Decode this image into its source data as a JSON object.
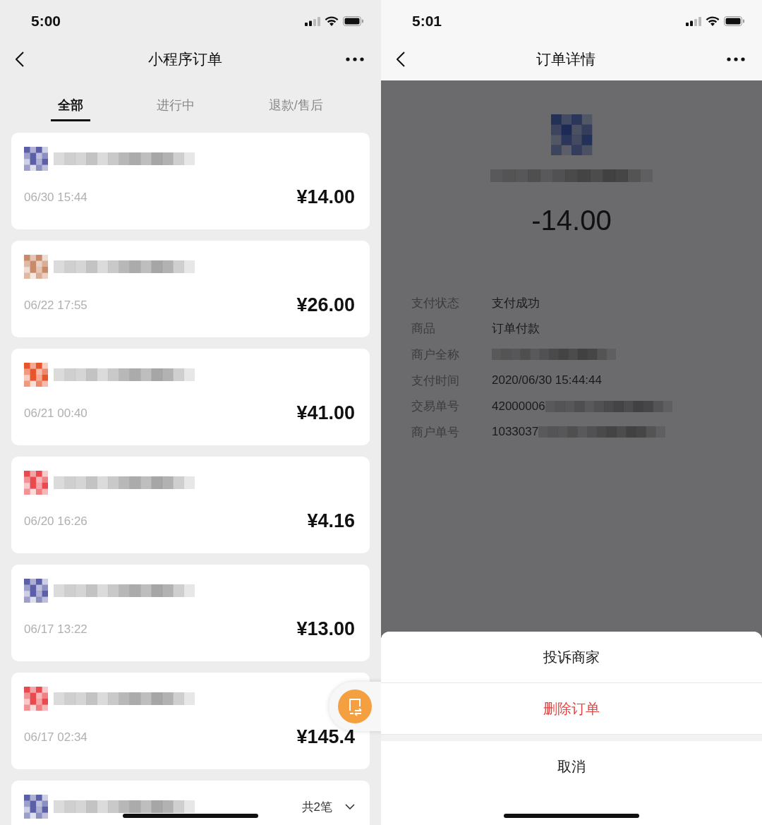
{
  "left": {
    "status_bar": {
      "time": "5:00"
    },
    "nav": {
      "title": "小程序订单"
    },
    "tabs": [
      {
        "label": "全部",
        "selected": true
      },
      {
        "label": "进行中",
        "selected": false
      },
      {
        "label": "退款/售后",
        "selected": false
      }
    ],
    "orders": [
      {
        "date": "06/30 15:44",
        "amount": "¥14.00",
        "color": "#5b5fa8"
      },
      {
        "date": "06/22 17:55",
        "amount": "¥26.00",
        "color": "#c98a6a"
      },
      {
        "date": "06/21 00:40",
        "amount": "¥41.00",
        "color": "#e8552a"
      },
      {
        "date": "06/20 16:26",
        "amount": "¥4.16",
        "color": "#e84a4f"
      },
      {
        "date": "06/17 13:22",
        "amount": "¥13.00",
        "color": "#5b5fa8"
      },
      {
        "date": "06/17 02:34",
        "amount": "¥145.4",
        "color": "#e84a4f"
      }
    ],
    "group": {
      "color": "#5b5fa8",
      "count": "共2笔"
    }
  },
  "right": {
    "status_bar": {
      "time": "5:01"
    },
    "nav": {
      "title": "订单详情"
    },
    "amount": "-14.00",
    "details": [
      {
        "label": "支付状态",
        "value": "支付成功",
        "kind": "plain"
      },
      {
        "label": "商品",
        "value": "订单付款",
        "kind": "plain"
      },
      {
        "label": "商户全称",
        "kind": "redacted"
      },
      {
        "label": "支付时间",
        "value": "2020/06/30 15:44:44",
        "kind": "plain"
      },
      {
        "label": "交易单号",
        "value": "42000006",
        "kind": "redacted"
      },
      {
        "label": "商户单号",
        "value": "1033037",
        "kind": "redacted"
      }
    ],
    "action_sheet": {
      "actions": [
        {
          "label": "投诉商家",
          "kind": "normal"
        },
        {
          "label": "删除订单",
          "kind": "danger"
        }
      ],
      "cancel": "取消"
    }
  }
}
